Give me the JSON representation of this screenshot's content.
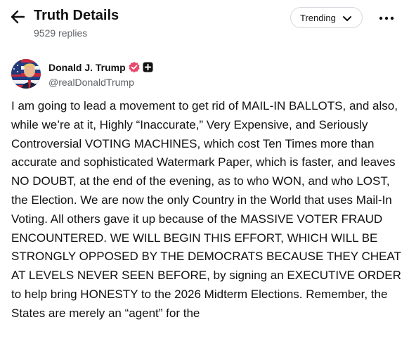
{
  "header": {
    "title": "Truth Details",
    "reply_count": "9529 replies",
    "sort_selected": "Trending",
    "back_icon": "arrow-left-icon",
    "more_icon": "more-horizontal-icon"
  },
  "post": {
    "author_name": "Donald J. Trump",
    "author_handle": "@realDonaldTrump",
    "verified_icon": "verified-check-icon",
    "badge_icon": "plus-square-icon",
    "text": "I am going to lead a movement to get rid of MAIL-IN BALLOTS, and also, while we’re at it, Highly “Inaccurate,” Very Expensive, and Seriously Controversial VOTING MACHINES, which cost Ten Times more than accurate and sophisticated Watermark Paper, which is faster, and leaves NO DOUBT, at the end of the evening, as to who WON, and who LOST, the Election. We are now the only Country in the World that uses Mail-In Voting. All others gave it up because of the MASSIVE VOTER FRAUD ENCOUNTERED. WE WILL BEGIN THIS EFFORT, WHICH WILL BE STRONGLY OPPOSED BY THE DEMOCRATS BECAUSE THEY CHEAT AT LEVELS NEVER SEEN BEFORE, by signing an EXECUTIVE ORDER to help bring HONESTY to the 2026 Midterm Elections. Remember, the States are merely an “agent” for the"
  },
  "colors": {
    "text_primary": "#111111",
    "text_secondary": "#5f6368",
    "verified_badge": "#e8486a",
    "border": "#d6d9de"
  }
}
